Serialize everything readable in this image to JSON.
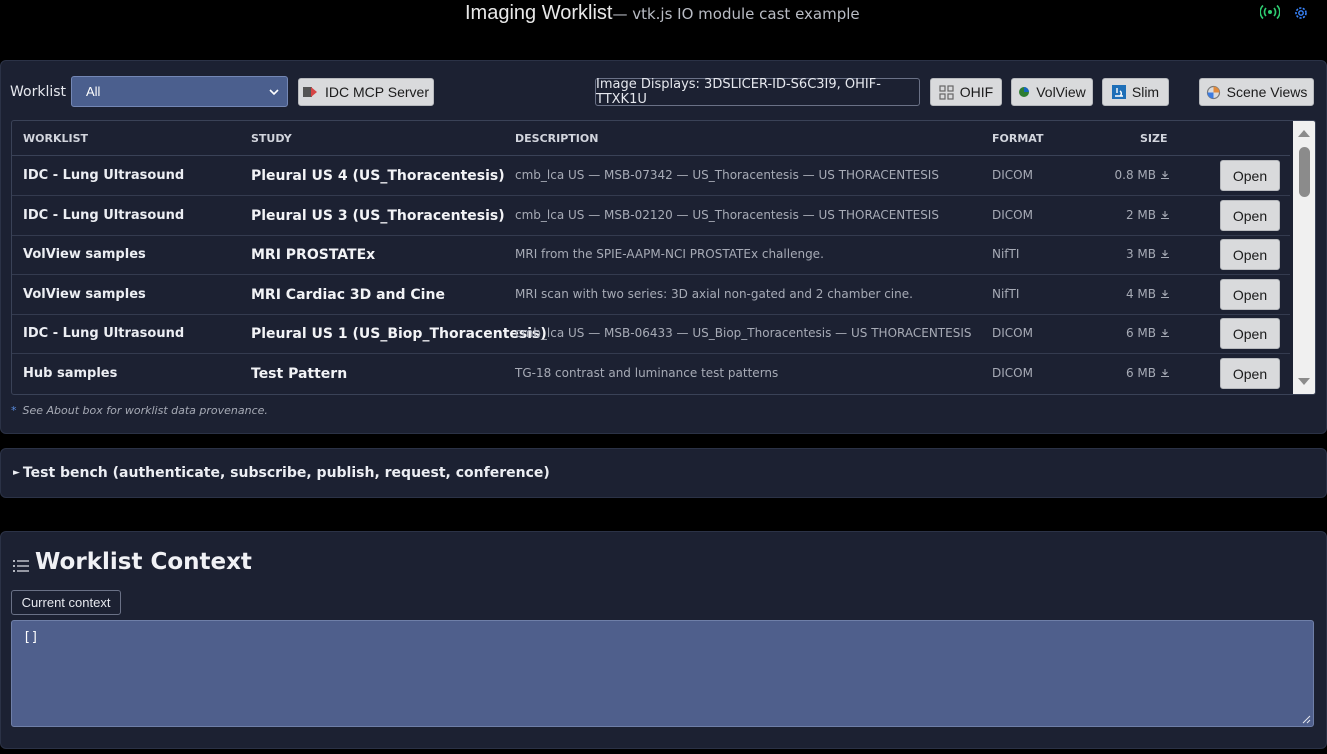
{
  "header": {
    "title": "Imaging Worklist",
    "subtitle": "— vtk.js IO module cast example",
    "icons": [
      "broadcast-icon",
      "gear-icon"
    ],
    "broadcast_color": "#2ecc71",
    "gear_color": "#3a86ff"
  },
  "toolbar": {
    "worklist_label": "Worklist",
    "worklist_selected": "All",
    "idc_button": "IDC MCP Server",
    "displays_button": "Image Displays: 3DSLICER-ID-S6C3I9, OHIF-TTXK1U",
    "ohif_button": "OHIF",
    "volview_button": "VolView",
    "slim_button": "Slim",
    "scene_button": "Scene Views"
  },
  "table": {
    "headers": {
      "worklist": "WORKLIST",
      "study": "STUDY",
      "description": "DESCRIPTION",
      "format": "FORMAT",
      "size": "SIZE"
    },
    "open_label": "Open",
    "rows": [
      {
        "worklist": "IDC - Lung Ultrasound",
        "study": "Pleural US 4 (US_Thoracentesis)",
        "description": "cmb_lca US — MSB-07342 — US_Thoracentesis — US THORACENTESIS",
        "format": "DICOM",
        "size": "0.8 MB"
      },
      {
        "worklist": "IDC - Lung Ultrasound",
        "study": "Pleural US 3 (US_Thoracentesis)",
        "description": "cmb_lca US — MSB-02120 — US_Thoracentesis — US THORACENTESIS",
        "format": "DICOM",
        "size": "2 MB"
      },
      {
        "worklist": "VolView samples",
        "study": "MRI PROSTATEx",
        "description": "MRI from the SPIE-AAPM-NCI PROSTATEx challenge.",
        "format": "NifTI",
        "size": "3 MB"
      },
      {
        "worklist": "VolView samples",
        "study": "MRI Cardiac 3D and Cine",
        "description": "MRI scan with two series: 3D axial non-gated and 2 chamber cine.",
        "format": "NifTI",
        "size": "4 MB"
      },
      {
        "worklist": "IDC - Lung Ultrasound",
        "study": "Pleural US 1 (US_Biop_Thoracentesis)",
        "description": "cmb_lca US — MSB-06433 — US_Biop_Thoracentesis — US THORACENTESIS",
        "format": "DICOM",
        "size": "6 MB"
      },
      {
        "worklist": "Hub samples",
        "study": "Test Pattern",
        "description": "TG-18 contrast and luminance test patterns",
        "format": "DICOM",
        "size": "6 MB"
      }
    ]
  },
  "footnote": {
    "star": "*",
    "text": "See About box for worklist data provenance."
  },
  "bench": {
    "label": "Test bench (authenticate, subscribe, publish, request, conference)"
  },
  "context": {
    "title": "Worklist Context",
    "button": "Current context",
    "value": "[]"
  }
}
